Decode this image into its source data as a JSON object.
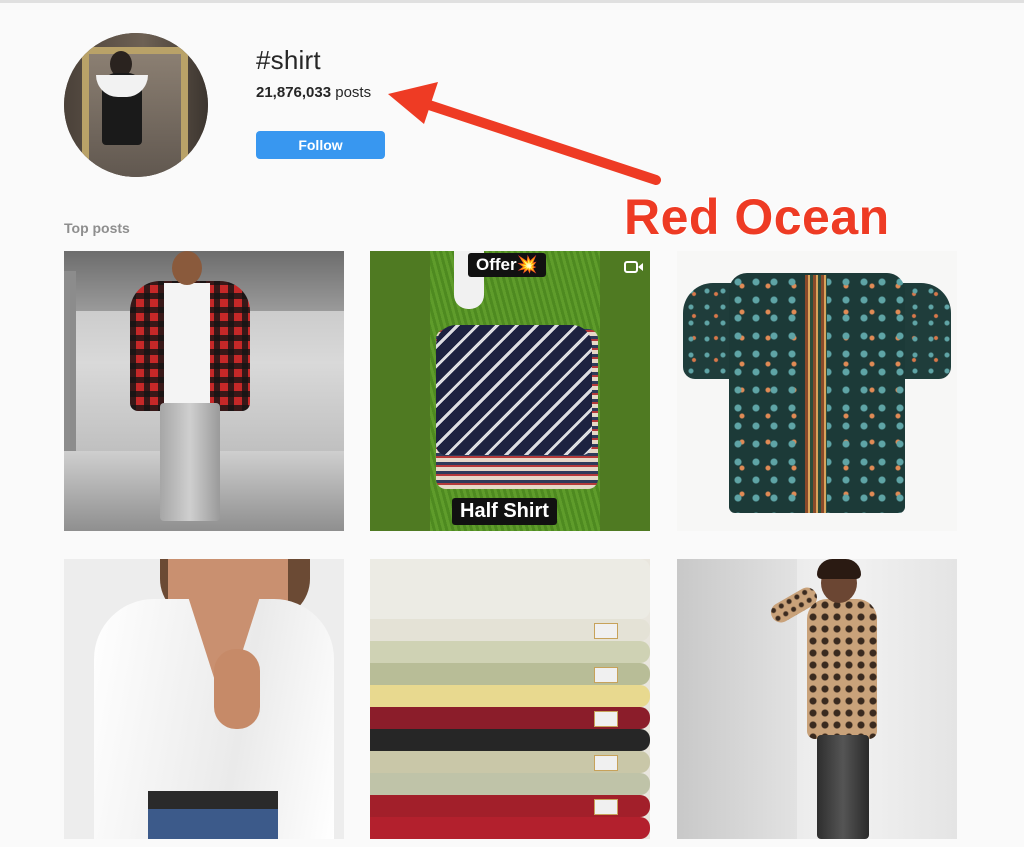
{
  "header": {
    "hashtag": "#shirt",
    "post_count": "21,876,033",
    "post_count_suffix": "posts",
    "follow_label": "Follow"
  },
  "annotation": {
    "text": "Red Ocean",
    "color": "#ee3b24"
  },
  "section": {
    "label": "Top posts"
  },
  "posts": [
    {
      "id": "post-1",
      "overlay_top": "",
      "overlay_bottom": ""
    },
    {
      "id": "post-2",
      "overlay_top": "Offer💥",
      "overlay_bottom": "Half Shirt",
      "video_icon": "video-icon"
    },
    {
      "id": "post-3",
      "overlay_top": "",
      "overlay_bottom": ""
    },
    {
      "id": "post-4",
      "overlay_top": "",
      "overlay_bottom": ""
    },
    {
      "id": "post-5",
      "overlay_top": "",
      "overlay_bottom": ""
    },
    {
      "id": "post-6",
      "overlay_top": "",
      "overlay_bottom": ""
    }
  ],
  "colors": {
    "accent": "#3897f0",
    "background": "#fafafa",
    "muted_text": "#8e8e8e"
  }
}
